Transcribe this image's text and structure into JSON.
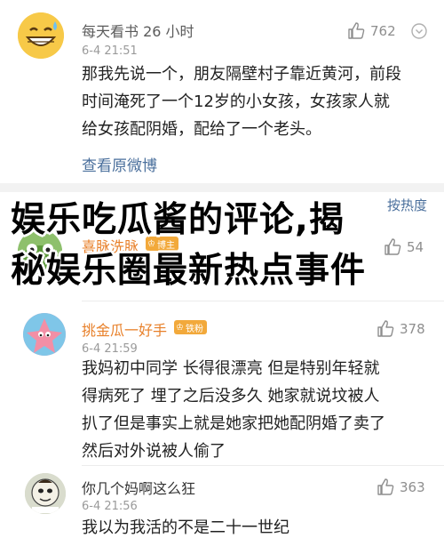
{
  "comments": [
    {
      "username": "每天看书 26 小时",
      "time": "6-4 21:51",
      "likes": "762",
      "lines": [
        "那我先说一个，朋友隔壁村子靠近黄河，前段",
        "时间淹死了一个12岁的小女孩，女孩家人就",
        "给女孩配阴婚，配给了一个老头。"
      ],
      "link": "查看原微博"
    },
    {
      "username": "喜脉洗脉",
      "badge": "博主",
      "likes": "54"
    },
    {
      "username": "挑金瓜一好手",
      "badge": "铁粉",
      "time": "6-4 21:59",
      "likes": "378",
      "lines": [
        "我妈初中同学 长得很漂亮 但是特别年轻就",
        "得病死了 埋了之后没多久 她家就说坟被人",
        "扒了但是事实上就是她家把她配阴婚了卖了",
        "然后对外说被人偷了"
      ]
    },
    {
      "username": "你几个妈啊这么狂",
      "time": "6-4 21:56",
      "likes": "363",
      "lines": [
        "我以为我活的不是二十一世纪"
      ]
    }
  ],
  "sort_label": "按热度",
  "overlay": {
    "line1": "娱乐吃瓜酱的评论,揭",
    "line2": "秘娱乐圈最新热点事件"
  },
  "colors": {
    "link": "#4a6f9c",
    "orange_name": "#e8802a",
    "badge": "#f2a93b"
  }
}
